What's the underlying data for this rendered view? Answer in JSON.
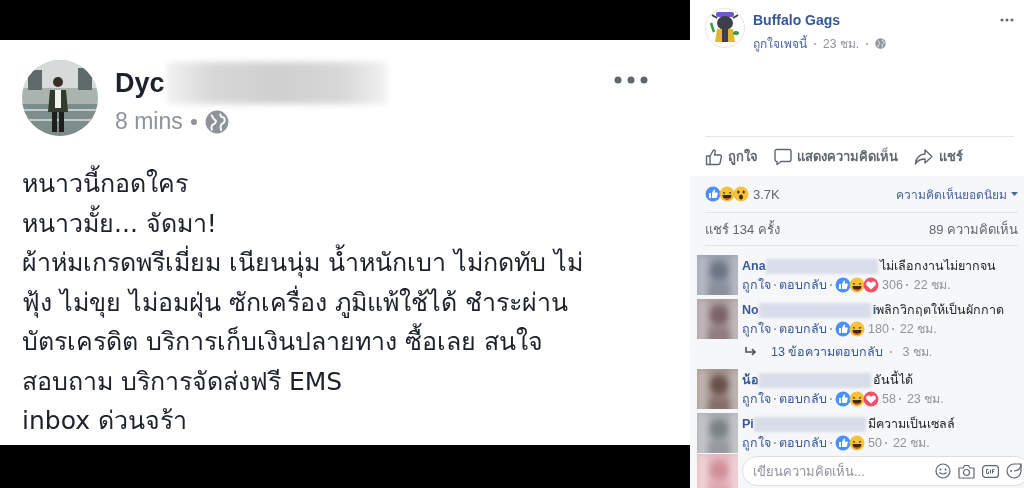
{
  "post": {
    "author": "Dyc",
    "time": "8 mins",
    "lines": [
      "หนาวนี้กอดใคร",
      "หนาวมั้ย... จัดมา!",
      "ผ้าห่มเกรดพรีเมี่ยม เนียนนุ่ม น้ำหนักเบา ไม่กดทับ ไม่",
      "ฟุ้ง ไม่ขุย ไม่อมฝุ่น ซักเครื่อง ภูมิแพ้ใช้ได้ ชำระผ่าน",
      "บัตรเครดิต บริการเก็บเงินปลายทาง ซื้อเลย สนใจ",
      "สอบถาม บริการจัดส่งฟรี EMS",
      "inbox ด่วนจร้า"
    ]
  },
  "sidebar": {
    "page_name": "Buffalo Gags",
    "page_meta": [
      "ถูกใจเพจนี้",
      "23 ชม."
    ],
    "actions": [
      {
        "kind": "like",
        "label": "ถูกใจ"
      },
      {
        "kind": "comment",
        "label": "แสดงความคิดเห็น"
      },
      {
        "kind": "share",
        "label": "แชร์"
      }
    ],
    "reactions": {
      "icons": [
        {
          "kind": "like"
        },
        {
          "kind": "haha"
        },
        {
          "kind": "wow"
        }
      ],
      "count": "3.7K"
    },
    "sort": "ความคิดเห็นยอดนิยม",
    "shares": "แชร์ 134 ครั้ง",
    "comment_count": "89 ความคิดเห็น",
    "comments": [
      {
        "kind": "comment",
        "name": "Ana",
        "text": "ไม่เลือกงานไม่ยากจน",
        "like": "ถูกใจ",
        "reply": "ตอบกลับ",
        "reactions": [
          {
            "kind": "like"
          },
          {
            "kind": "haha"
          },
          {
            "kind": "love"
          }
        ],
        "count": "306",
        "time": "22 ชม."
      },
      {
        "kind": "comment",
        "name": "No",
        "name_end": "i",
        "text": "พลิกวิกฤตให้เป็นผักกาด",
        "like": "ถูกใจ",
        "reply": "ตอบกลับ",
        "reactions": [
          {
            "kind": "like"
          },
          {
            "kind": "haha"
          }
        ],
        "count": "180",
        "time": "22 ชม."
      },
      {
        "kind": "replies",
        "text": "13 ข้อความตอบกลับ",
        "time": "3 ชม."
      },
      {
        "kind": "comment",
        "name": "น้อ",
        "text": "อันนี้ได้",
        "like": "ถูกใจ",
        "reply": "ตอบกลับ",
        "reactions": [
          {
            "kind": "like"
          },
          {
            "kind": "haha"
          },
          {
            "kind": "love"
          }
        ],
        "count": "58",
        "time": "23 ชม."
      },
      {
        "kind": "comment",
        "name": "Pi",
        "text": "มีความเป็นเซลล์",
        "like": "ถูกใจ",
        "reply": "ตอบกลับ",
        "reactions": [
          {
            "kind": "like"
          },
          {
            "kind": "haha"
          }
        ],
        "count": "50",
        "time": "22 ชม."
      }
    ],
    "composer": {
      "placeholder": "เขียนความคิดเห็น..."
    }
  }
}
